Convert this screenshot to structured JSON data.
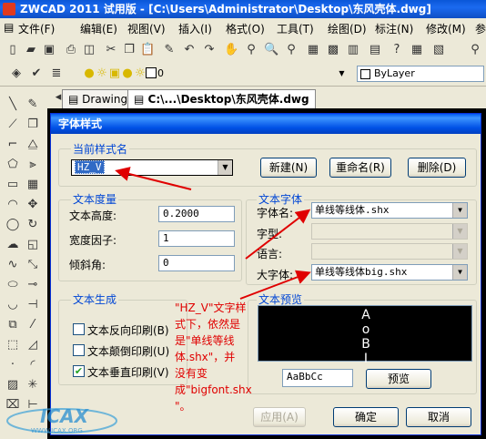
{
  "window": {
    "title": "ZWCAD 2011 试用版 - [C:\\Users\\Administrator\\Desktop\\东风壳体.dwg]"
  },
  "menu": [
    "文件(F)",
    "编辑(E)",
    "视图(V)",
    "插入(I)",
    "格式(O)",
    "工具(T)",
    "绘图(D)",
    "标注(N)",
    "修改(M)",
    "参"
  ],
  "toolbar": {
    "layer_value": "0",
    "color_value": "ByLayer"
  },
  "tabs": [
    {
      "label": "Drawing1"
    },
    {
      "label": "C:\\...\\Desktop\\东风壳体.dwg"
    }
  ],
  "dialog": {
    "title": "字体样式",
    "current_style": {
      "label": "当前样式名",
      "value": "HZ_V",
      "btn_new": "新建(N)",
      "btn_rename": "重命名(R)",
      "btn_delete": "删除(D)"
    },
    "metrics": {
      "label": "文本度量",
      "height_label": "文本高度:",
      "height_value": "0.2000",
      "width_label": "宽度因子:",
      "width_value": "1",
      "oblique_label": "倾斜角:",
      "oblique_value": "0"
    },
    "font": {
      "label": "文本字体",
      "name_label": "字体名:",
      "name_value": "单线等线体.shx",
      "style_label": "字型:",
      "lang_label": "语言:",
      "bigfont_label": "大字体:",
      "bigfont_value": "单线等线体big.shx"
    },
    "generation": {
      "label": "文本生成",
      "backwards": "文本反向印刷(B)",
      "upside": "文本颠倒印刷(U)",
      "vertical": "文本垂直印刷(V)",
      "vertical_checked": true
    },
    "preview": {
      "label": "文本预览",
      "chars": [
        "A",
        "o",
        "B",
        "I"
      ],
      "sample_text": "AaBbCc",
      "btn_preview": "预览"
    },
    "buttons": {
      "apply": "应用(A)",
      "ok": "确定",
      "cancel": "取消"
    },
    "annotation": [
      "\"HZ_V\"文字样",
      "式下，依然是",
      "是\"单线等线",
      "体.shx\"，并",
      "没有变",
      "成\"bigfont.shx",
      "\"。"
    ]
  },
  "watermark": {
    "text": "ICAX",
    "site": "WWW.ICAX.ORG"
  },
  "colors": {
    "annotation": "#e00000",
    "titlebar": "#0a57d8",
    "dialog_title": "#0058ee",
    "group_label": "#0046d5"
  }
}
